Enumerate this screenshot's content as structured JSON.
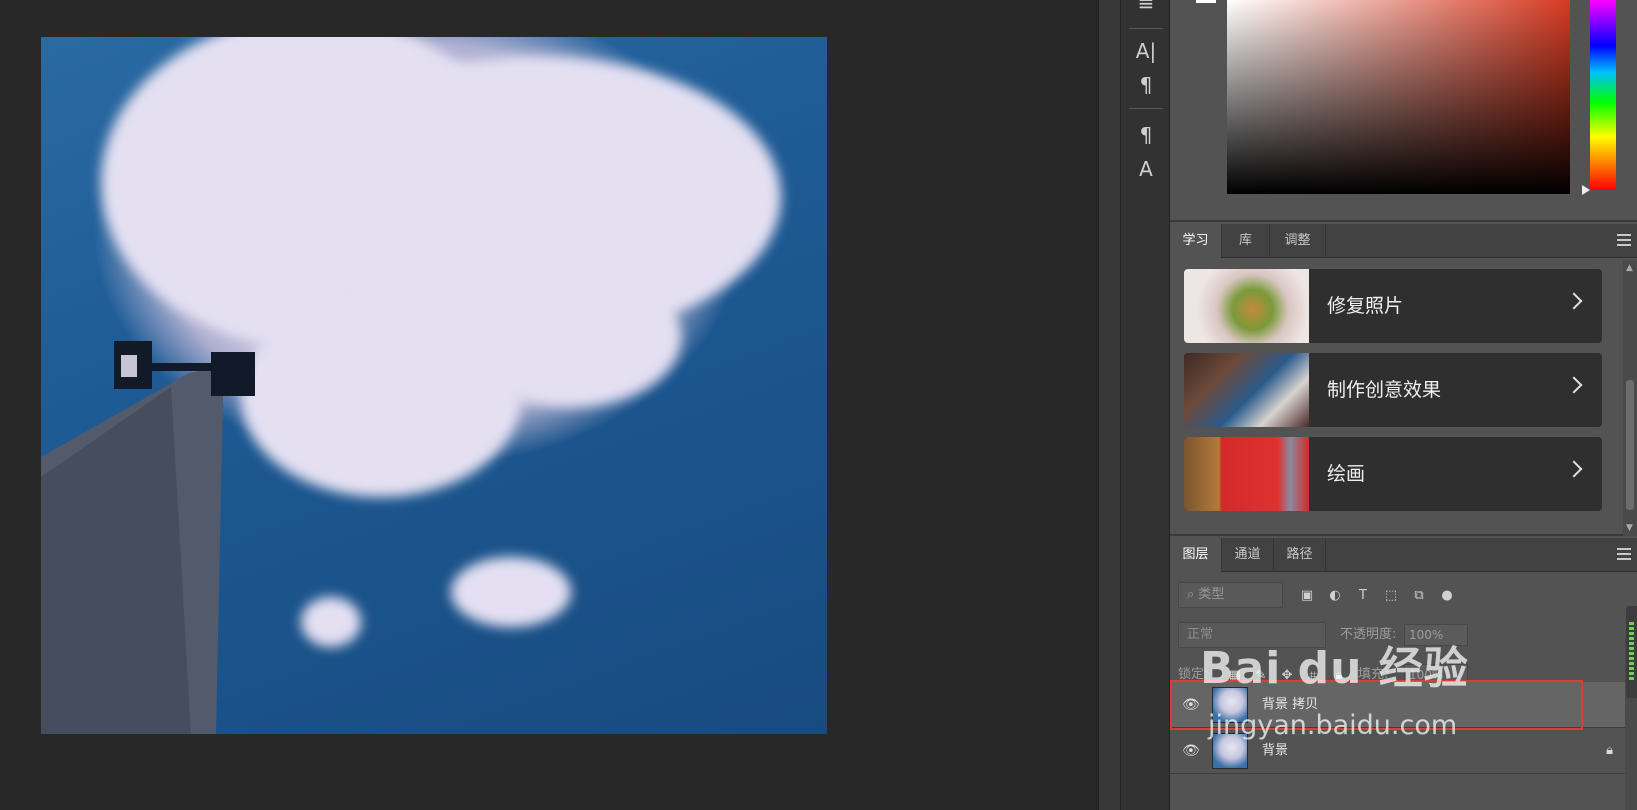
{
  "learn_panel": {
    "tabs": [
      "学习",
      "库",
      "调整"
    ],
    "cards": [
      {
        "label": "修复照片"
      },
      {
        "label": "制作创意效果"
      },
      {
        "label": "绘画"
      }
    ]
  },
  "layers_panel": {
    "tabs": [
      "图层",
      "通道",
      "路径"
    ],
    "filter_placeholder": "类型",
    "blend_mode": "正常",
    "opacity_label": "不透明度:",
    "opacity_value": "100%",
    "lock_label": "锁定:",
    "fill_label": "填充:",
    "fill_value": "100%",
    "layers": [
      {
        "name": "背景 拷贝",
        "selected": true,
        "visible": true,
        "locked": false
      },
      {
        "name": "背景",
        "selected": false,
        "visible": true,
        "locked": true
      }
    ]
  },
  "colors": {
    "panel_bg": "#535353",
    "canvas_bg": "#282828",
    "highlight": "#e03a3a"
  },
  "icons": {
    "eye": "eye-icon",
    "lock": "lock-icon",
    "chevron": "chevron-right-icon"
  },
  "watermark": {
    "logo": "Bai du 经验",
    "url": "jingyan.baidu.com"
  }
}
